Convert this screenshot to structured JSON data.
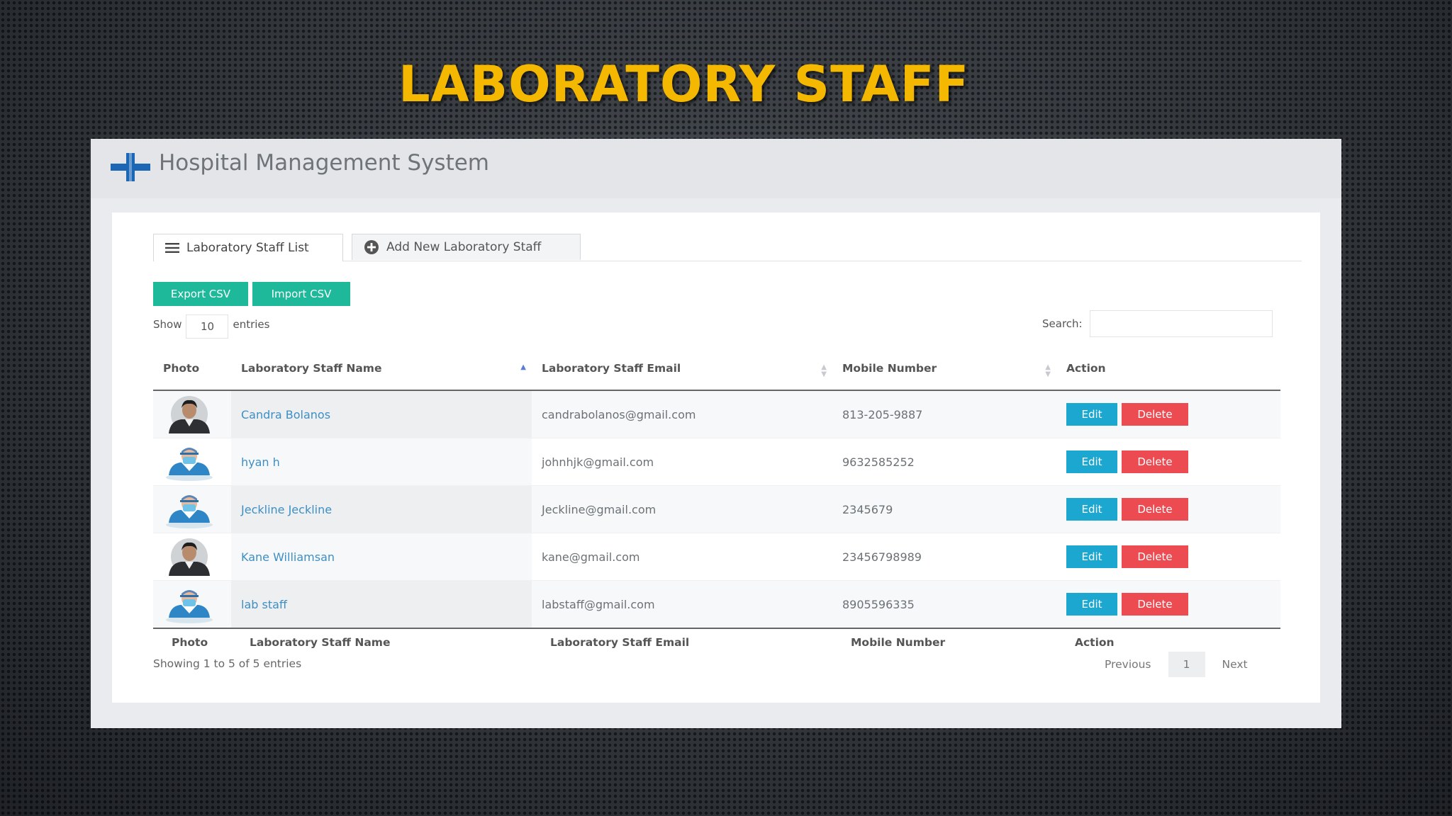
{
  "slide": {
    "title": "LABORATORY STAFF"
  },
  "app": {
    "title": "Hospital Management System"
  },
  "tabs": [
    {
      "label": "Laboratory Staff List",
      "icon": "list-icon",
      "active": true
    },
    {
      "label": "Add New Laboratory Staff",
      "icon": "plus-circle-icon",
      "active": false
    }
  ],
  "toolbar": {
    "export_label": "Export CSV",
    "import_label": "Import CSV"
  },
  "length": {
    "show_label": "Show",
    "value": "10",
    "entries_label": "entries"
  },
  "search": {
    "label": "Search:",
    "value": ""
  },
  "table": {
    "headers": [
      "Photo",
      "Laboratory Staff Name",
      "Laboratory Staff Email",
      "Mobile Number",
      "Action"
    ],
    "rows": [
      {
        "photo": "male-photo-avatar",
        "name": "Candra Bolanos",
        "email": "candrabolanos@gmail.com",
        "mobile": "813-205-9887"
      },
      {
        "photo": "masked-staff-avatar",
        "name": "hyan h",
        "email": "johnhjk@gmail.com",
        "mobile": "9632585252"
      },
      {
        "photo": "masked-staff-avatar",
        "name": "Jeckline Jeckline",
        "email": "Jeckline@gmail.com",
        "mobile": "2345679"
      },
      {
        "photo": "male-photo-avatar",
        "name": "Kane Williamsan",
        "email": "kane@gmail.com",
        "mobile": "23456798989"
      },
      {
        "photo": "masked-staff-avatar",
        "name": "lab staff",
        "email": "labstaff@gmail.com",
        "mobile": "8905596335"
      }
    ],
    "edit_label": "Edit",
    "delete_label": "Delete"
  },
  "footer": {
    "info": "Showing 1 to 5 of 5 entries",
    "previous": "Previous",
    "page": "1",
    "next": "Next"
  },
  "colors": {
    "title": "#f5b800",
    "export": "#1eb89a",
    "edit": "#1ba7cf",
    "delete": "#ec4b52",
    "link": "#3d8fc4"
  }
}
